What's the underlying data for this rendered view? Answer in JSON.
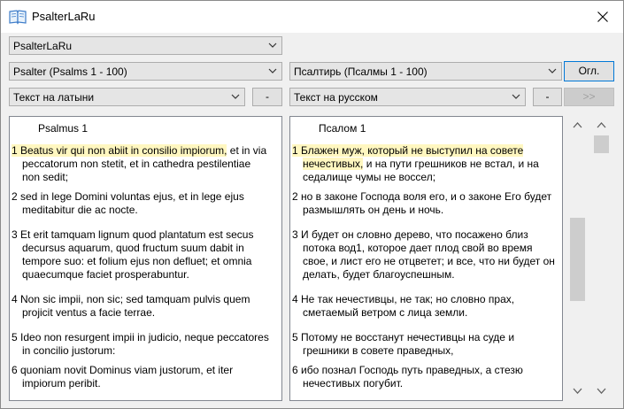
{
  "window": {
    "title": "PsalterLaRu"
  },
  "top_select": {
    "value": "PsalterLaRu"
  },
  "left": {
    "book_select": "Psalter (Psalms 1 - 100)",
    "text_select": "Текст на латыни",
    "minus_label": "-",
    "heading": "Psalmus 1",
    "verses": [
      {
        "first": "1 Beatus vir qui non abiit in consilio impiorum,",
        "first_rest": " et in via",
        "cont": [
          "peccatorum non stetit,  et in cathedra pestilentiae",
          "non sedit;"
        ]
      },
      {
        "first": "2 sed in lege Domini voluntas ejus,  et in lege ejus",
        "cont": [
          "meditabitur die ac nocte."
        ]
      },
      {
        "first": "3 Et erit tamquam lignum  quod plantatum est secus",
        "cont": [
          "decursus aquarum,  quod fructum suum dabit in",
          "tempore suo:  et folium ejus non defluet;  et omnia",
          "quaecumque faciet prosperabuntur."
        ]
      },
      {
        "first": "4 Non sic impii, non sic;  sed tamquam pulvis  quem",
        "cont": [
          "projicit ventus a facie terrae."
        ]
      },
      {
        "first": "5 Ideo non resurgent impii in judicio,  neque peccatores",
        "cont": [
          "in concilio justorum:"
        ]
      },
      {
        "first": "6 quoniam novit Dominus viam justorum,  et iter",
        "cont": [
          "impiorum peribit."
        ]
      }
    ]
  },
  "right": {
    "book_select": "Псалтирь (Псалмы 1 - 100)",
    "toc_label": "Огл.",
    "text_select": "Текст на русском",
    "minus_label": "-",
    "next_label": ">>",
    "heading": "Псалом 1",
    "verses": [
      {
        "first": "1 Блажен муж, который не выступил на совете",
        "cont_hl": "нечестивых,",
        "cont_rest": "  и на пути грешников не встал,  и на",
        "cont": [
          "седалище чумы не воссел;"
        ]
      },
      {
        "first": "2 но в законе Господа воля его,  и о законе Его будет",
        "cont": [
          "размышлять он день и ночь."
        ]
      },
      {
        "first": "3 И будет он словно дерево,  что посажено близ",
        "cont": [
          "потока вод1,  которое дает плод свой во время",
          "свое,  и лист его не отцветет;  и все, что ни будет он",
          "делать, будет благоуспешным."
        ]
      },
      {
        "first": "4 Не так нечестивцы, не так;  но словно прах,",
        "cont": [
          "сметаемый ветром с лица земли."
        ]
      },
      {
        "first": "5 Потому не восстанут нечестивцы на суде  и",
        "cont": [
          "грешники в совете праведных,"
        ]
      },
      {
        "first": "6 ибо познал Господь путь праведных,  а стезю",
        "cont": [
          "нечестивых погубит."
        ]
      }
    ]
  },
  "icons": {
    "app": "book-icon",
    "close": "close-icon",
    "dropdown": "chevron-down-icon",
    "scroll_up": "chevron-up-icon",
    "scroll_down": "chevron-down-icon"
  },
  "colors": {
    "highlight": "#fff7c0",
    "scroll_thumb": "#cdcdcd",
    "focus_border": "#0078d7"
  }
}
